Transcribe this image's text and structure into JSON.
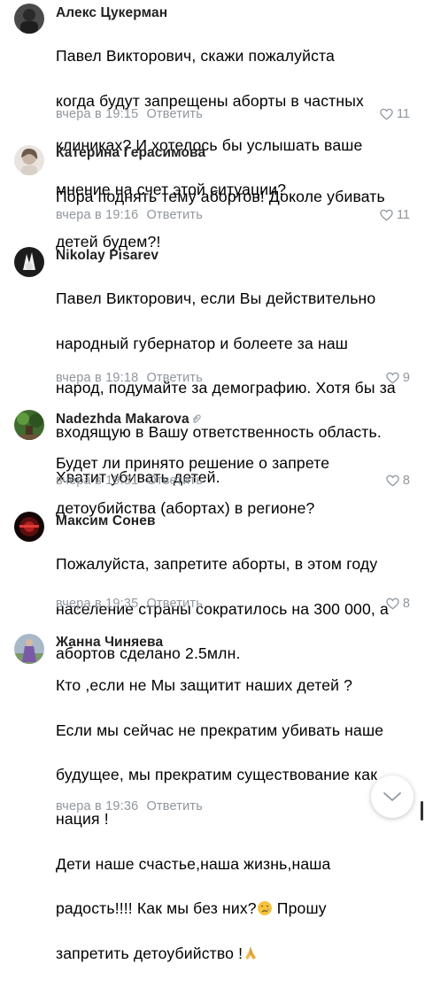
{
  "comments": [
    {
      "author": "Алекс Цукерман",
      "lines": [
        "Павел Викторович, скажи пожалуйста",
        "когда будут запрещены аборты в частных",
        "клиниках? И хотелось бы услышать ваше",
        "мнение на счет этой ситуации?"
      ],
      "time": "вчера в 19:15",
      "reply": "Ответить",
      "likes": "11"
    },
    {
      "author": "Катерина Герасимова",
      "lines": [
        "Пора поднять тему абортов! Доколе убивать",
        "детей будем?!"
      ],
      "time": "вчера в 19:16",
      "reply": "Ответить",
      "likes": "11"
    },
    {
      "author": "Nikolay Pisarev",
      "lines": [
        "Павел Викторович, если Вы действительно",
        "народный губернатор и болеете за наш",
        "народ, подумайте за демографию. Хотя бы за",
        "входящую в Вашу ответственность область.",
        "Хватит убивать детей."
      ],
      "time": "вчера в 19:18",
      "reply": "Ответить",
      "likes": "9"
    },
    {
      "author": "Nadezhda Makarova",
      "lines": [
        "Будет ли принято решение о запрете",
        "детоубийства (абортах) в регионе?"
      ],
      "time": "вчера в 19:31",
      "reply": "Ответить",
      "likes": "8"
    },
    {
      "author": "Максим Сонев",
      "lines": [
        "Пожалуйста, запретите аборты, в этом году",
        "население страны сократилось на 300 000, а",
        "абортов сделано 2.5млн."
      ],
      "time": "вчера в 19:35",
      "reply": "Ответить",
      "likes": "8"
    },
    {
      "author": "Жанна Чиняева",
      "lines": [
        "Кто ,если не Мы защитит наших детей ?",
        "Если мы сейчас не прекратим убивать наше",
        "будущее, мы прекратим существование как",
        "нация !",
        "Дети  наше счастье,наша жизнь,наша",
        "радость!!!! Как мы без них?",
        " Прошу",
        "запретить детоубийство !"
      ],
      "time": "вчера в 19:36",
      "reply": "Ответить",
      "likes": ""
    }
  ],
  "icons": {
    "like": "heart-outline-icon",
    "attachment": "paperclip-icon",
    "scroll": "chevron-down-icon",
    "emoji_1": "crying-face-emoji",
    "emoji_2": "folded-hands-emoji"
  },
  "colors": {
    "meta": "#8f969d",
    "text": "#000000"
  }
}
